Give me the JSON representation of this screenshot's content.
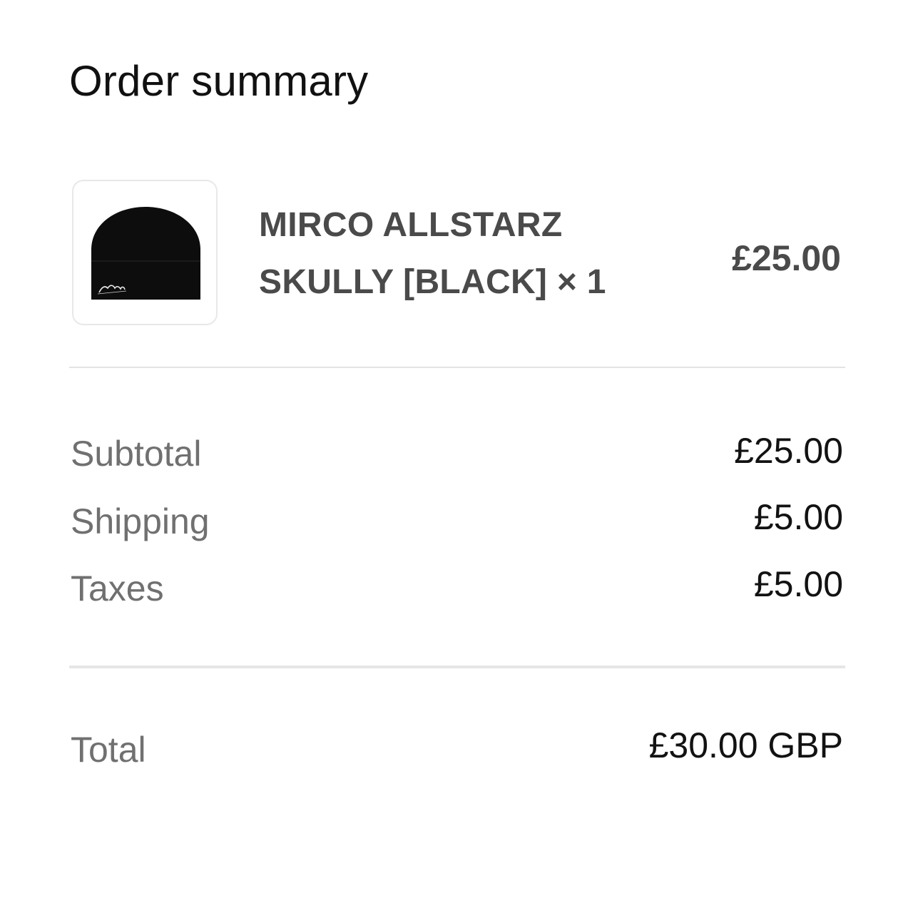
{
  "order_summary": {
    "title": "Order summary",
    "item": {
      "name": "MIRCO ALLSTARZ SKULLY [BLACK] × 1",
      "price": "£25.00",
      "image_icon": "beanie-image",
      "logo_text": "Corteiz"
    },
    "rows": {
      "subtotal": {
        "label": "Subtotal",
        "value": "£25.00"
      },
      "shipping": {
        "label": "Shipping",
        "value": "£5.00"
      },
      "taxes": {
        "label": "Taxes",
        "value": "£5.00"
      }
    },
    "total": {
      "label": "Total",
      "value": "£30.00 GBP"
    }
  }
}
